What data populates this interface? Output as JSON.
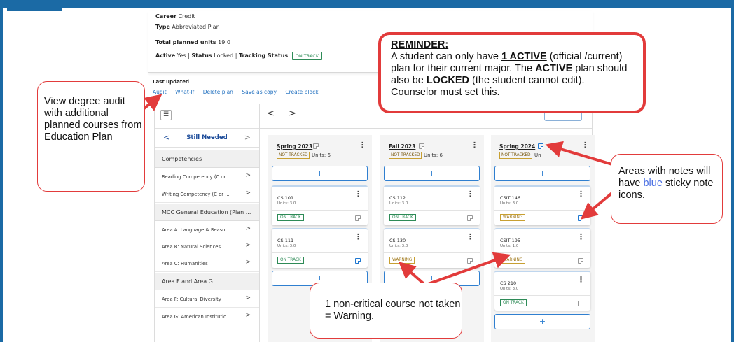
{
  "plan_info": {
    "career_label": "Career",
    "career_value": "Credit",
    "type_label": "Type",
    "type_value": "Abbreviated Plan",
    "total_units_label": "Total planned units",
    "total_units_value": "19.0",
    "active_label": "Active",
    "active_value": "Yes",
    "status_label": "Status",
    "status_value": "Locked",
    "tracking_label": "Tracking Status",
    "tracking_value": "ON TRACK"
  },
  "last_updated_label": "Last updated",
  "actions": [
    "Audit",
    "What-If",
    "Delete plan",
    "Save as copy",
    "Create block"
  ],
  "sidebar": {
    "menu_icon": "menu-icon",
    "title": "Still Needed",
    "groups": [
      {
        "label": "Competencies",
        "items": [
          "Reading Competency (C or ...",
          "Writing Competency (C or ..."
        ]
      },
      {
        "label": "MCC General Education (Plan ...",
        "items": [
          "Area A: Language & Reaso...",
          "Area B: Natural Sciences",
          "Area C: Humanities"
        ]
      },
      {
        "label": "Area F and Area G",
        "items": [
          "Area F: Cultural Diversity",
          "Area G: American Institutio..."
        ]
      }
    ]
  },
  "nav": {
    "prev": "<",
    "next": ">"
  },
  "terms": [
    {
      "title": "Spring 2023",
      "note_blue": false,
      "tracked": "NOT TRACKED",
      "units": "Units: 6",
      "courses": [
        {
          "name": "CS 101",
          "units": "Units: 3.0",
          "status": "ON TRACK",
          "note_blue": false
        },
        {
          "name": "CS 111",
          "units": "Units: 3.0",
          "status": "ON TRACK",
          "note_blue": true
        }
      ]
    },
    {
      "title": "Fall 2023",
      "note_blue": false,
      "tracked": "NOT TRACKED",
      "units": "Units: 6",
      "courses": [
        {
          "name": "CS 112",
          "units": "Units: 3.0",
          "status": "ON TRACK",
          "note_blue": false
        },
        {
          "name": "CS 130",
          "units": "Units: 3.0",
          "status": "WARNING",
          "note_blue": false
        }
      ]
    },
    {
      "title": "Spring 2024",
      "note_blue": true,
      "tracked": "NOT TRACKED",
      "units": "Un",
      "courses": [
        {
          "name": "CSIT 146",
          "units": "Units: 3.0",
          "status": "WARNING",
          "note_blue": true
        },
        {
          "name": "CSIT 195",
          "units": "Units: 1.0",
          "status": "WARNING",
          "note_blue": false
        },
        {
          "name": "CS 210",
          "units": "Units: 3.0",
          "status": "ON TRACK",
          "note_blue": false
        }
      ]
    }
  ],
  "add_symbol": "+",
  "callouts": {
    "reminder_title": "REMINDER:",
    "reminder_p1": "A student can only have ",
    "reminder_b1": "1 ACTIVE",
    "reminder_p2": " (official /current) plan for their current major. The ",
    "reminder_b2": "ACTIVE",
    "reminder_p3": " plan should also be ",
    "reminder_b3": "LOCKED",
    "reminder_p4": " (the student cannot edit). Counselor must set this.",
    "audit": "View degree audit with additional planned courses from Education Plan",
    "notes_p1": "Areas with notes will have ",
    "notes_blue": "blue",
    "notes_p2": " sticky note icons.",
    "warning": "1 non-critical course not taken = Warning."
  },
  "colors": {
    "accent_blue": "#1b6aa5",
    "link_blue": "#1f6fbf",
    "callout_red": "#e23b3b",
    "on_track_green": "#2e8b57",
    "warning_gold": "#c8a032"
  }
}
